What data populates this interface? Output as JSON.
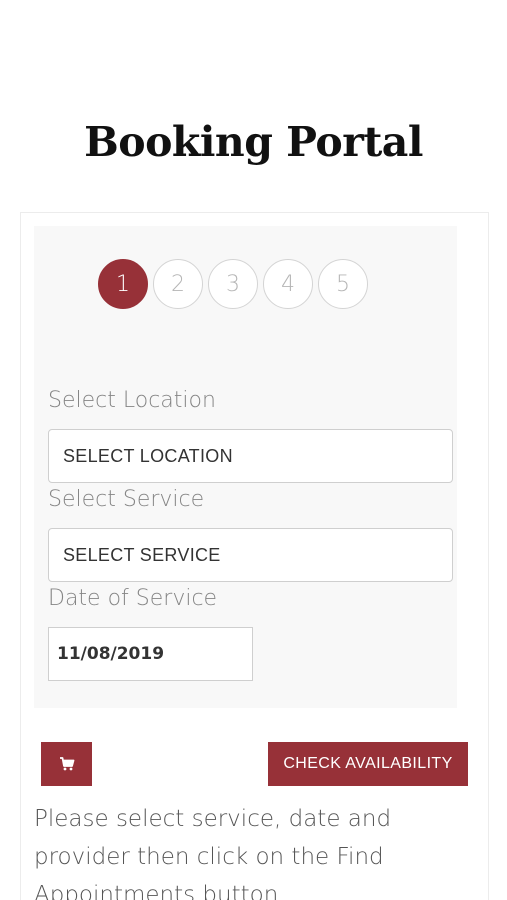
{
  "header": {
    "title": "Booking Portal"
  },
  "steps": {
    "items": [
      "1",
      "2",
      "3",
      "4",
      "5"
    ],
    "active": "1"
  },
  "form": {
    "location_label": "Select Location",
    "location_value": "SELECT LOCATION",
    "service_label": "Select Service",
    "service_value": "SELECT SERVICE",
    "date_label": "Date of Service",
    "date_value": "11/08/2019"
  },
  "actions": {
    "cart_icon": "cart-icon",
    "check_label": "CHECK AVAILABILITY"
  },
  "help": {
    "text": "Please select service, date and provider then click on the Find Appointments button"
  },
  "colors": {
    "accent": "#973138",
    "panel_background": "#f8f8f8",
    "label_text": "#858585"
  }
}
